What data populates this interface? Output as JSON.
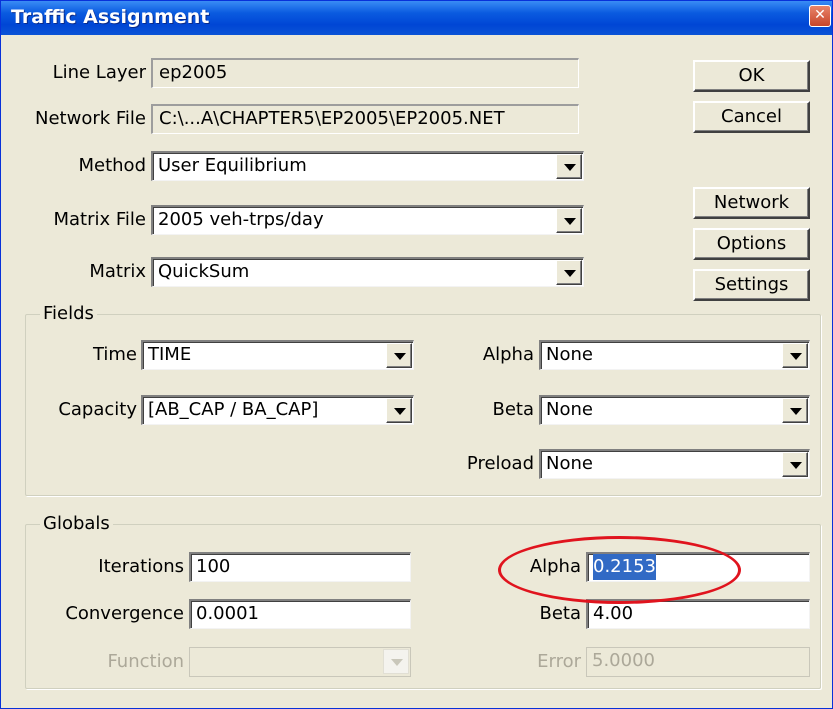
{
  "window": {
    "title": "Traffic Assignment"
  },
  "line_layer": {
    "label": "Line Layer",
    "value": "ep2005"
  },
  "network_file": {
    "label": "Network File",
    "value": "C:\\...A\\CHAPTER5\\EP2005\\EP2005.NET"
  },
  "method": {
    "label": "Method",
    "value": "User Equilibrium"
  },
  "matrix_file": {
    "label": "Matrix File",
    "value": "2005 veh-trps/day"
  },
  "matrix": {
    "label": "Matrix",
    "value": "QuickSum"
  },
  "buttons": {
    "ok": "OK",
    "cancel": "Cancel",
    "network": "Network",
    "options": "Options",
    "settings": "Settings"
  },
  "fields": {
    "title": "Fields",
    "time": {
      "label": "Time",
      "value": "TIME"
    },
    "capacity": {
      "label": "Capacity",
      "value": "[AB_CAP / BA_CAP]"
    },
    "alpha": {
      "label": "Alpha",
      "value": "None"
    },
    "beta": {
      "label": "Beta",
      "value": "None"
    },
    "preload": {
      "label": "Preload",
      "value": "None"
    }
  },
  "globals": {
    "title": "Globals",
    "iterations": {
      "label": "Iterations",
      "value": "100"
    },
    "convergence": {
      "label": "Convergence",
      "value": "0.0001"
    },
    "function": {
      "label": "Function",
      "value": ""
    },
    "alpha": {
      "label": "Alpha",
      "value": "0.2153"
    },
    "beta": {
      "label": "Beta",
      "value": "4.00"
    },
    "error": {
      "label": "Error",
      "value": "5.0000"
    }
  },
  "colors": {
    "titlebar": "#0a5be0",
    "dialog": "#ece9d8",
    "highlight": "#316ac5",
    "annotation": "#e0141e"
  },
  "icons": {
    "close": "close-icon",
    "dropdown": "chevron-down-icon"
  }
}
